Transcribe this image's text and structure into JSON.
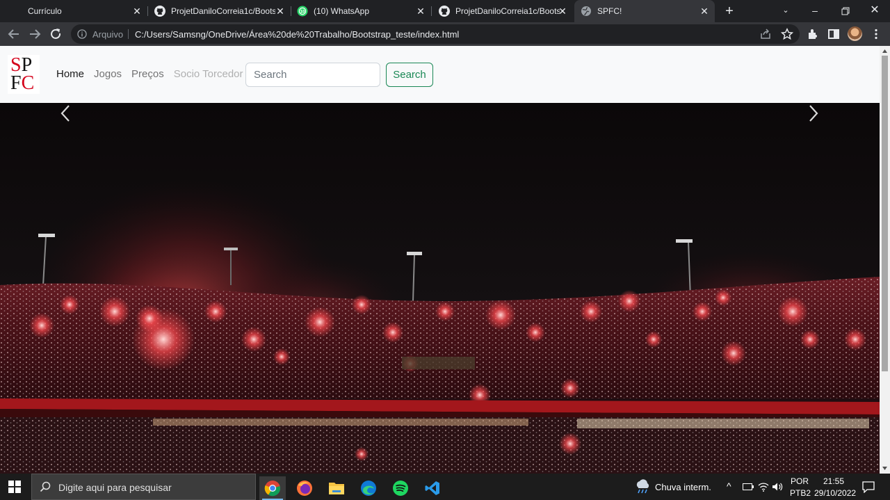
{
  "browser": {
    "tabs": [
      {
        "title": "Currículo",
        "icon": "blank-page-icon",
        "active": false
      },
      {
        "title": "ProjetDaniloCorreia1c/Bootst",
        "icon": "github-icon",
        "active": false
      },
      {
        "title": "(10) WhatsApp",
        "icon": "whatsapp-icon",
        "active": false
      },
      {
        "title": "ProjetDaniloCorreia1c/Bootst",
        "icon": "github-icon",
        "active": false
      },
      {
        "title": "SPFC!",
        "icon": "globe-icon",
        "active": true
      }
    ],
    "address": {
      "scheme_label": "Arquivo",
      "url": "C:/Users/Samsng/OneDrive/Área%20de%20Trabalho/Bootstrap_teste/index.html"
    }
  },
  "page": {
    "brand": {
      "row1_a": "S",
      "row1_b": "P",
      "row2_a": "F",
      "row2_b": "C"
    },
    "nav": [
      {
        "label": "Home",
        "state": "active"
      },
      {
        "label": "Jogos",
        "state": "normal"
      },
      {
        "label": "Preços",
        "state": "normal"
      },
      {
        "label": "Socio Torcedor",
        "state": "disabled"
      }
    ],
    "search": {
      "placeholder": "Search",
      "button_label": "Search"
    },
    "carousel": {
      "image": "stadium-crowd-flares-photo"
    }
  },
  "taskbar": {
    "search_placeholder": "Digite aqui para pesquisar",
    "weather": "Chuva interm.",
    "lang_top": "POR",
    "lang_bottom": "PTB2",
    "time": "21:55",
    "date": "29/10/2022"
  },
  "colors": {
    "accent_green": "#198754",
    "brand_red": "#d4001a"
  }
}
